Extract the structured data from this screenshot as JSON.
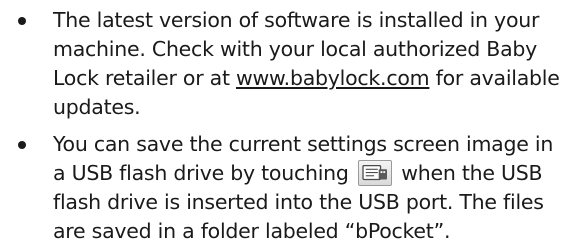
{
  "notes": [
    {
      "before": "The latest version of software is installed in your machine. Check with your local authorized Baby Lock retailer or at ",
      "link": "www.babylock.com",
      "after": " for available updates."
    },
    {
      "before": "You can save the current settings screen image in a USB flash drive by touching ",
      "icon": "save-screen-to-usb-icon",
      "after": " when the USB flash drive is inserted into the USB port. The files are saved in a folder labeled “bPocket”."
    }
  ]
}
